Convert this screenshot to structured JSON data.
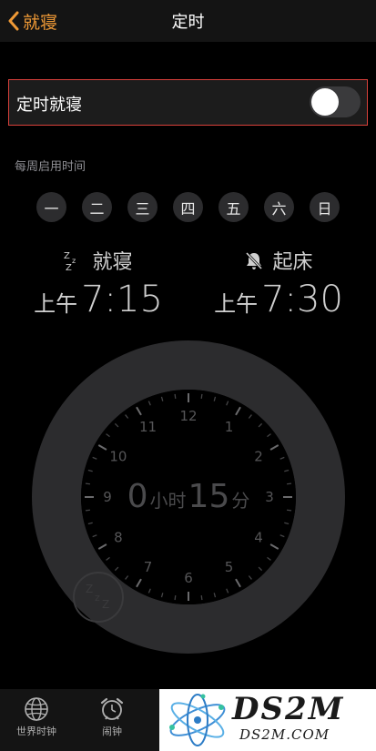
{
  "nav": {
    "back_label": "就寝",
    "title": "定时"
  },
  "schedule": {
    "label": "定时就寝",
    "enabled": false
  },
  "section_label": "每周启用时间",
  "days": [
    "一",
    "二",
    "三",
    "四",
    "五",
    "六",
    "日"
  ],
  "bedtime": {
    "label": "就寝",
    "period": "上午",
    "time": "7:15"
  },
  "wake": {
    "label": "起床",
    "period": "上午",
    "time": "7:30"
  },
  "duration": {
    "hours": "0",
    "hours_unit": "小时",
    "minutes": "15",
    "minutes_unit": "分"
  },
  "dial_numbers": [
    "12",
    "1",
    "2",
    "3",
    "4",
    "5",
    "6",
    "7",
    "8",
    "9",
    "10",
    "11"
  ],
  "tabs": [
    {
      "label": "世界时钟",
      "icon": "globe-icon"
    },
    {
      "label": "闹钟",
      "icon": "alarm-clock-icon"
    }
  ],
  "watermark": {
    "main": "DS2M",
    "sub": "DS2M.COM"
  },
  "colors": {
    "accent": "#f09a36",
    "highlight_border": "#d8403b",
    "ring": "#2c2c2e"
  }
}
